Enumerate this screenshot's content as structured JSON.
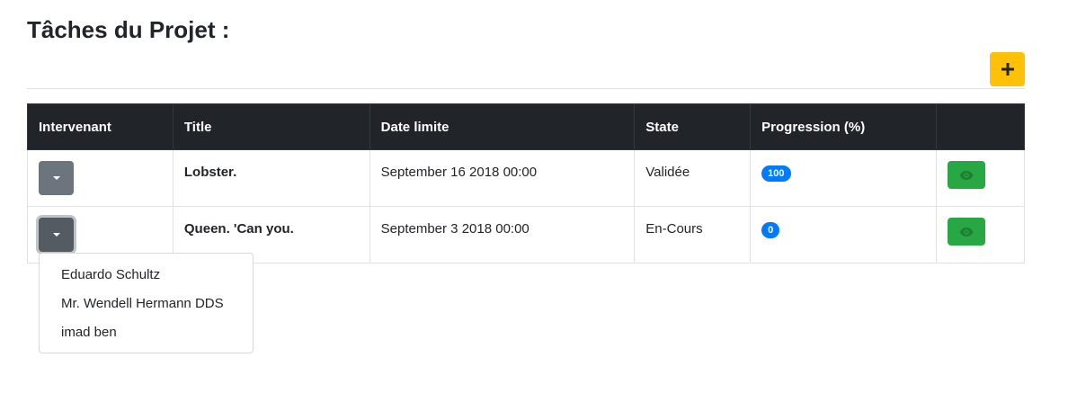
{
  "header": {
    "title": "Tâches du Projet :"
  },
  "toolbar": {
    "add_icon": "plus-icon",
    "add_color": "#ffc107"
  },
  "table": {
    "columns": [
      "Intervenant",
      "Title",
      "Date limite",
      "State",
      "Progression (%)",
      ""
    ],
    "rows": [
      {
        "title": "Lobster.",
        "date": "September 16 2018 00:00",
        "state": "Validée",
        "progress": "100"
      },
      {
        "title": "Queen. 'Can you.",
        "date": "September 3 2018 00:00",
        "state": "En-Cours",
        "progress": "0"
      }
    ]
  },
  "dropdown": {
    "open_row": 1,
    "items": [
      "Eduardo Schultz",
      "Mr. Wendell Hermann DDS",
      "imad ben"
    ]
  },
  "colors": {
    "header_bg": "#212529",
    "badge": "#007bff",
    "view_button": "#28a745",
    "dropdown_button": "#6c757d"
  }
}
